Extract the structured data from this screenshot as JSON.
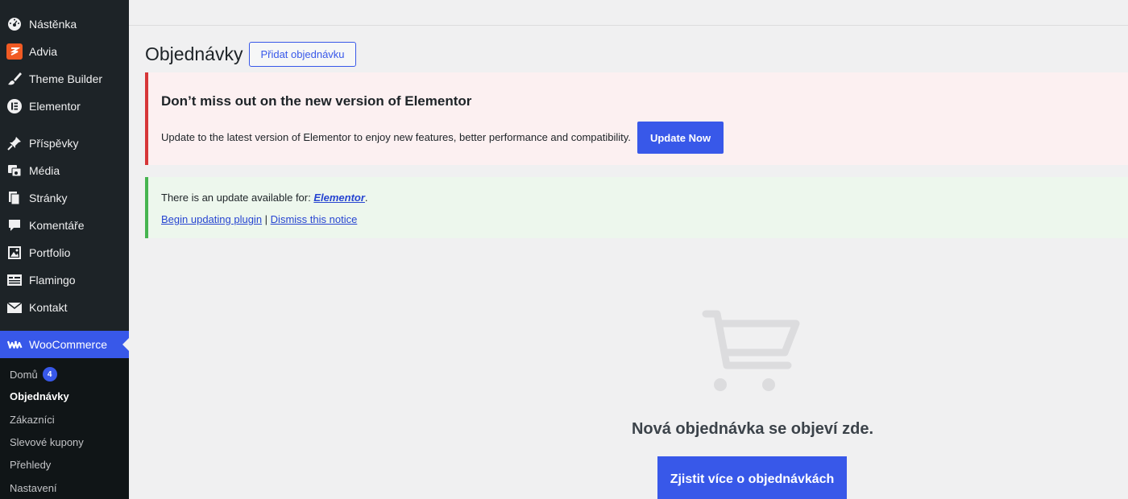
{
  "sidebar": {
    "items": [
      {
        "label": "Nástěnka",
        "icon": "dashboard-icon"
      },
      {
        "label": "Advia",
        "icon": "advia-icon"
      },
      {
        "label": "Theme Builder",
        "icon": "brush-icon"
      },
      {
        "label": "Elementor",
        "icon": "elementor-icon"
      },
      {
        "label": "Příspěvky",
        "icon": "pin-icon"
      },
      {
        "label": "Média",
        "icon": "media-icon"
      },
      {
        "label": "Stránky",
        "icon": "pages-icon"
      },
      {
        "label": "Komentáře",
        "icon": "comment-icon"
      },
      {
        "label": "Portfolio",
        "icon": "portfolio-icon"
      },
      {
        "label": "Flamingo",
        "icon": "flamingo-icon"
      },
      {
        "label": "Kontakt",
        "icon": "mail-icon"
      },
      {
        "label": "WooCommerce",
        "icon": "woo-icon"
      }
    ],
    "submenu": [
      {
        "label": "Domů",
        "badge": "4"
      },
      {
        "label": "Objednávky"
      },
      {
        "label": "Zákazníci"
      },
      {
        "label": "Slevové kupony"
      },
      {
        "label": "Přehledy"
      },
      {
        "label": "Nastavení"
      }
    ]
  },
  "header": {
    "title": "Objednávky",
    "add_button": "Přidat objednávku"
  },
  "notice_elementor": {
    "title": "Don’t miss out on the new version of Elementor",
    "text": "Update to the latest version of Elementor to enjoy new features, better performance and compatibility.",
    "button": "Update Now"
  },
  "notice_update": {
    "prefix": "There is an update available for: ",
    "plugin": "Elementor",
    "suffix": ".",
    "begin_link": "Begin updating plugin",
    "separator": " | ",
    "dismiss_link": "Dismiss this notice"
  },
  "empty_state": {
    "message": "Nová objednávka se objeví zde.",
    "button": "Zjistit více o objednávkách",
    "icon": "cart-icon"
  },
  "colors": {
    "accent": "#3858e9",
    "sidebar_bg": "#1d2327",
    "error": "#d63638",
    "success": "#46b450"
  }
}
